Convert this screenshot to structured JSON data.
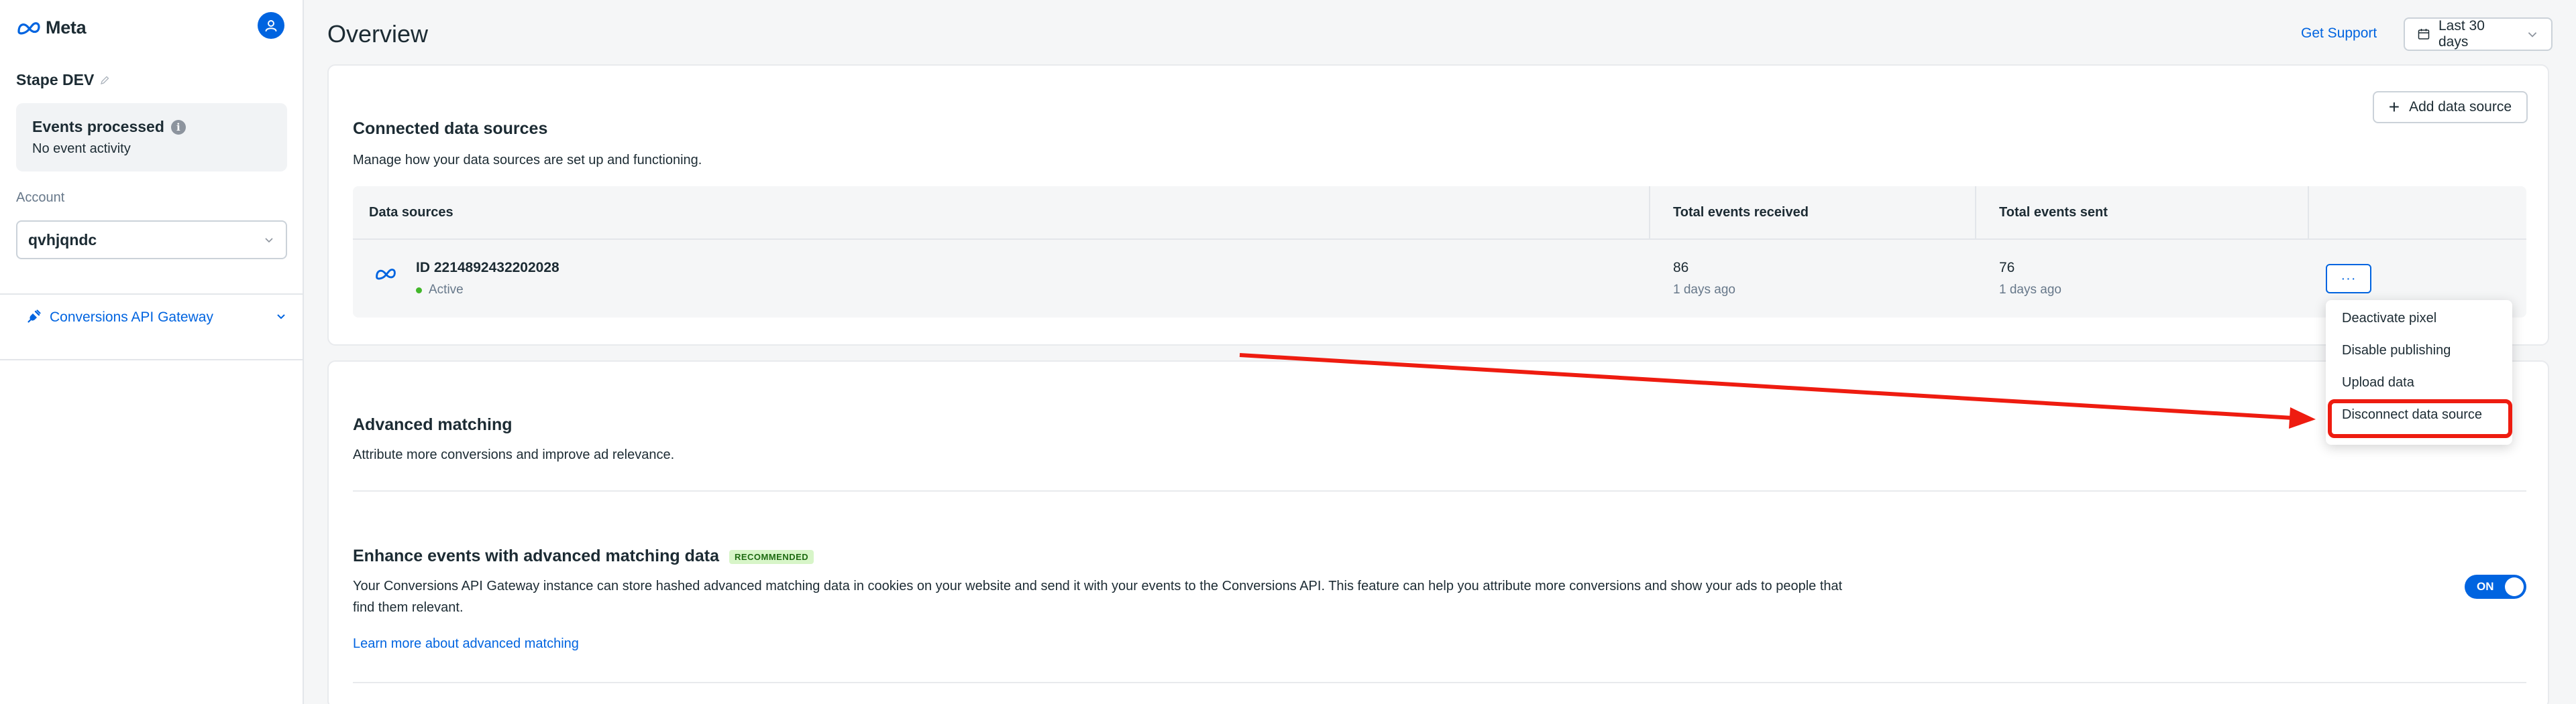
{
  "sidebar": {
    "brand": "Meta",
    "account_name": "Stape DEV",
    "events": {
      "title": "Events processed",
      "subtitle": "No event activity"
    },
    "account_label": "Account",
    "account_value": "qvhjqndc",
    "nav_item": "Conversions API Gateway"
  },
  "header": {
    "title": "Overview",
    "support_link": "Get Support",
    "date_range": "Last 30 days"
  },
  "connected": {
    "title": "Connected data sources",
    "description": "Manage how your data sources are set up and functioning.",
    "add_button": "Add data source",
    "columns": [
      "Data sources",
      "Total events received",
      "Total events sent"
    ],
    "row": {
      "id": "ID 2214892432202028",
      "status": "Active",
      "received": "86",
      "received_sub": "1 days ago",
      "sent": "76",
      "sent_sub": "1 days ago"
    },
    "more_button": "···"
  },
  "menu": {
    "items": [
      "Deactivate pixel",
      "Disable publishing",
      "Upload data",
      "Disconnect data source"
    ]
  },
  "advanced": {
    "title": "Advanced matching",
    "description": "Attribute more conversions and improve ad relevance.",
    "enhance_title": "Enhance events with advanced matching data",
    "badge": "RECOMMENDED",
    "enhance_desc_1": "Your Conversions API Gateway instance can store hashed advanced matching data in cookies on your website and send it with your events to the Conversions API. This feature can help you attribute more conversions and show your ads to people that",
    "enhance_desc_2": "find them relevant.",
    "learn_link": "Learn more about advanced matching",
    "toggle_label": "ON"
  },
  "colors": {
    "accent": "#0064e0",
    "highlight": "#ee1c10",
    "active": "#42b72a"
  },
  "icons": {
    "brand": "meta-infinity-icon",
    "avatar": "user-icon",
    "edit": "pencil-icon",
    "info": "info-icon",
    "select": "chevron-down-icon",
    "nav": "plug-icon",
    "date": "calendar-icon",
    "add": "plus-icon"
  }
}
